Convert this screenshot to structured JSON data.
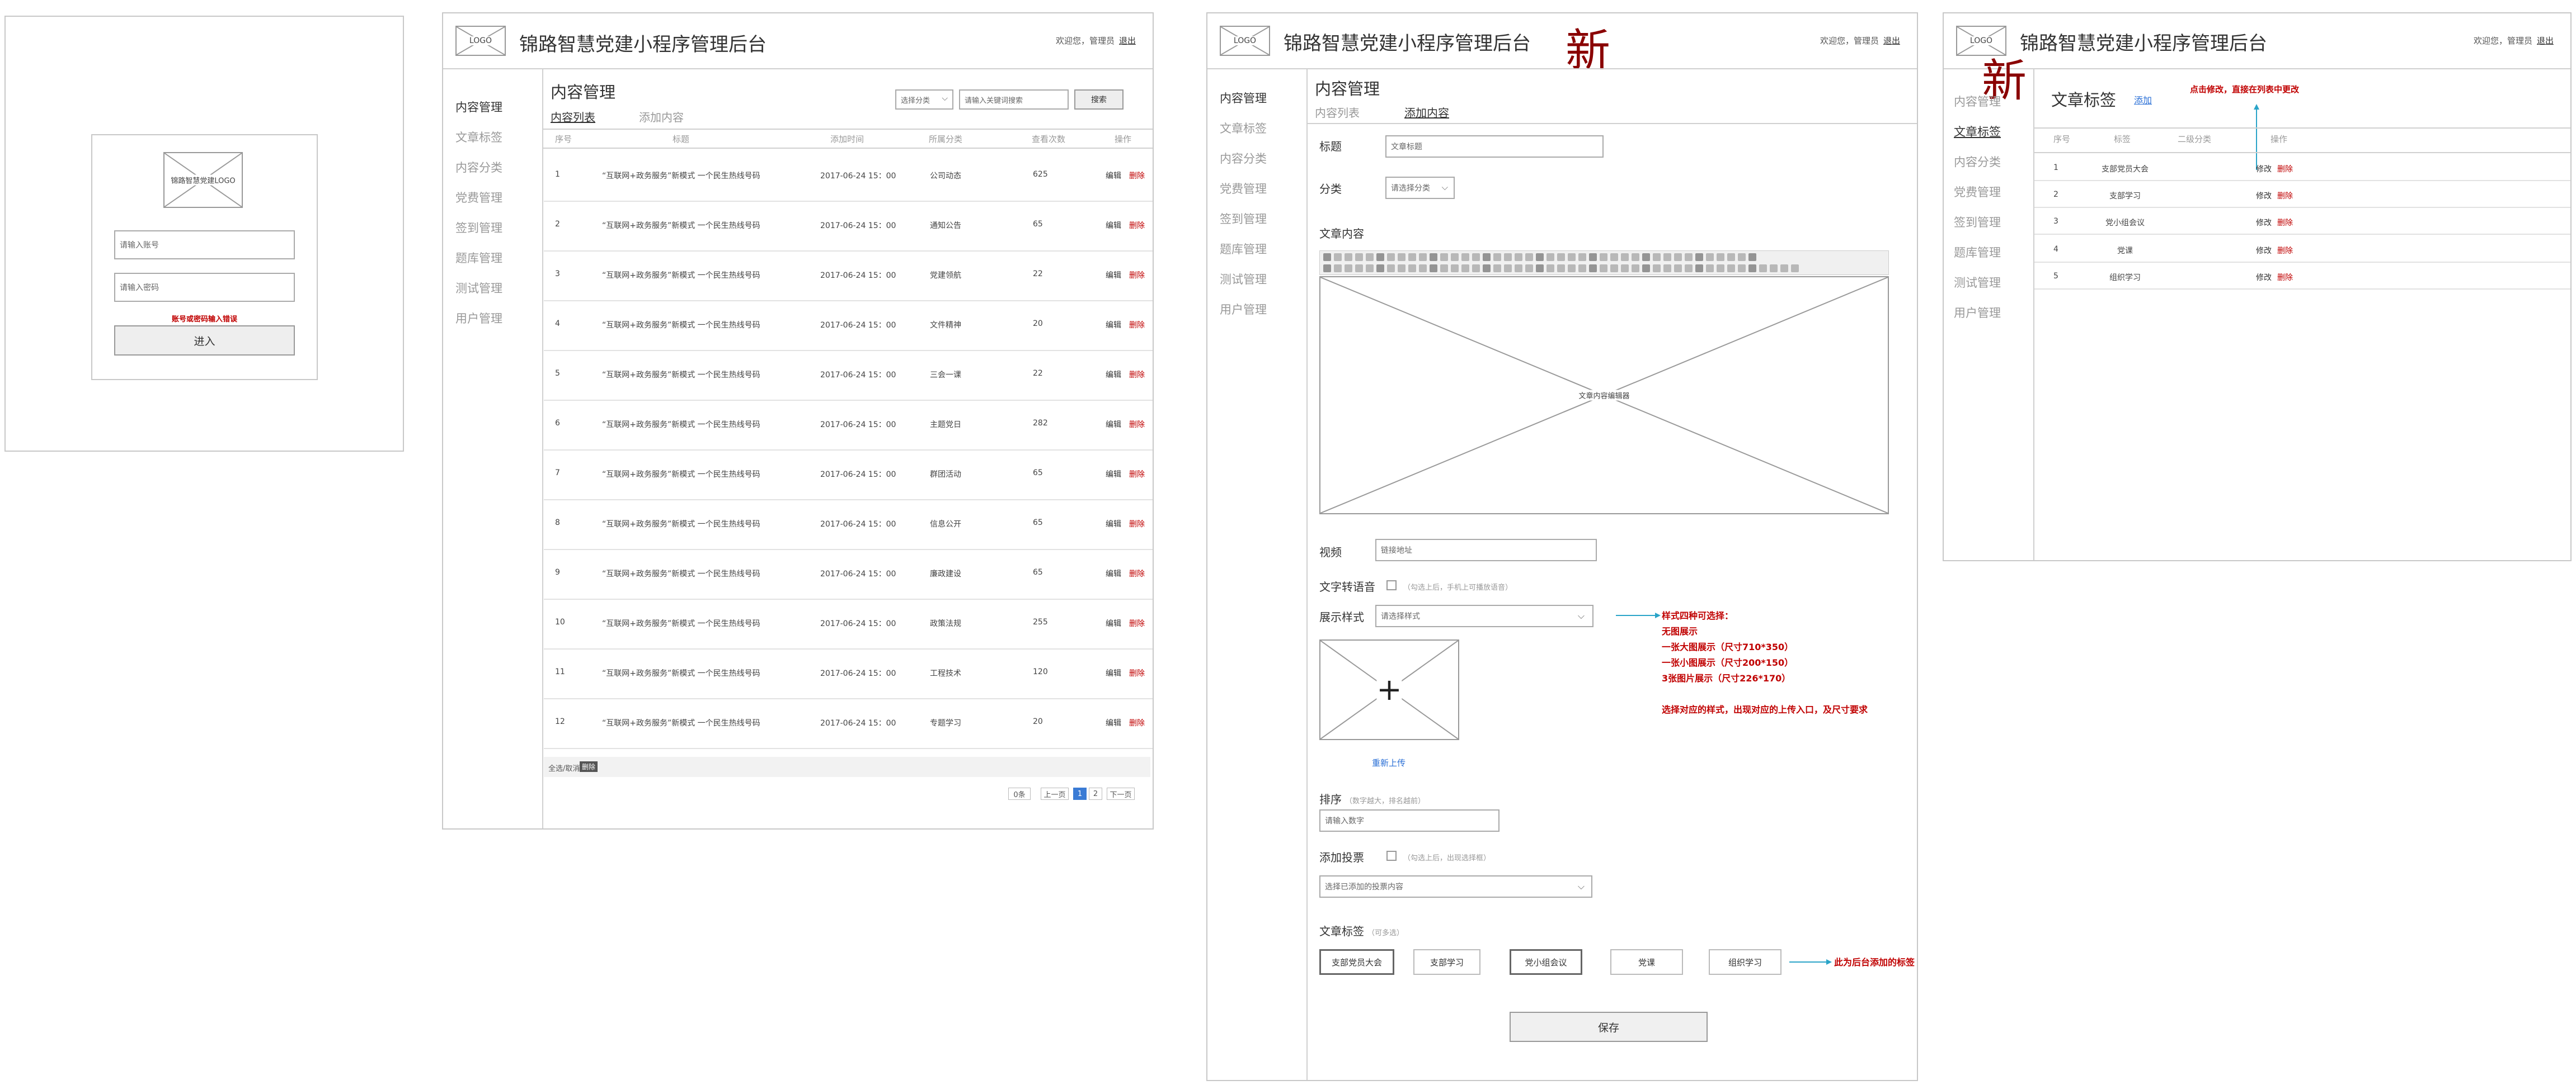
{
  "login": {
    "logo_text": "锦路智慧党建LOGO",
    "account_placeholder": "请输入账号",
    "password_placeholder": "请输入密码",
    "error": "账号或密码输入错误",
    "submit_label": "进入"
  },
  "common": {
    "logo": "LOGO",
    "app_title": "锦路智慧党建小程序管理后台",
    "welcome": "欢迎您，管理员",
    "logout": "退出",
    "new_marker": "新"
  },
  "sidebar": {
    "items": [
      "内容管理",
      "文章标签",
      "内容分类",
      "党费管理",
      "签到管理",
      "题库管理",
      "测试管理",
      "用户管理"
    ]
  },
  "content_list": {
    "page_title": "内容管理",
    "tabs": [
      "内容列表",
      "添加内容"
    ],
    "category_select": "选择分类",
    "search_placeholder": "请输入关键词搜索",
    "search_button": "搜索",
    "columns": [
      "序号",
      "标题",
      "添加时间",
      "所属分类",
      "查看次数",
      "操作"
    ],
    "edit_label": "编辑",
    "delete_label": "删除",
    "rows": [
      {
        "no": "1",
        "title": "“互联网+政务服务”新模式 一个民生热线号码",
        "time": "2017-06-24 15：00",
        "category": "公司动态",
        "views": "625"
      },
      {
        "no": "2",
        "title": "“互联网+政务服务”新模式 一个民生热线号码",
        "time": "2017-06-24 15：00",
        "category": "通知公告",
        "views": "65"
      },
      {
        "no": "3",
        "title": "“互联网+政务服务”新模式 一个民生热线号码",
        "time": "2017-06-24 15：00",
        "category": "党建领航",
        "views": "22"
      },
      {
        "no": "4",
        "title": "“互联网+政务服务”新模式 一个民生热线号码",
        "time": "2017-06-24 15：00",
        "category": "文件精神",
        "views": "20"
      },
      {
        "no": "5",
        "title": "“互联网+政务服务”新模式 一个民生热线号码",
        "time": "2017-06-24 15：00",
        "category": "三会一课",
        "views": "22"
      },
      {
        "no": "6",
        "title": "“互联网+政务服务”新模式 一个民生热线号码",
        "time": "2017-06-24 15：00",
        "category": "主题党日",
        "views": "282"
      },
      {
        "no": "7",
        "title": "“互联网+政务服务”新模式 一个民生热线号码",
        "time": "2017-06-24 15：00",
        "category": "群团活动",
        "views": "65"
      },
      {
        "no": "8",
        "title": "“互联网+政务服务”新模式 一个民生热线号码",
        "time": "2017-06-24 15：00",
        "category": "信息公开",
        "views": "65"
      },
      {
        "no": "9",
        "title": "“互联网+政务服务”新模式 一个民生热线号码",
        "time": "2017-06-24 15：00",
        "category": "廉政建设",
        "views": "65"
      },
      {
        "no": "10",
        "title": "“互联网+政务服务”新模式 一个民生热线号码",
        "time": "2017-06-24 15：00",
        "category": "政策法规",
        "views": "255"
      },
      {
        "no": "11",
        "title": "“互联网+政务服务”新模式 一个民生热线号码",
        "time": "2017-06-24 15：00",
        "category": "工程技术",
        "views": "120"
      },
      {
        "no": "12",
        "title": "“互联网+政务服务”新模式 一个民生热线号码",
        "time": "2017-06-24 15：00",
        "category": "专题学习",
        "views": "20"
      }
    ],
    "footer_select_all": "全选/取消",
    "footer_delete": "删除",
    "pager": {
      "total": "0条",
      "prev": "上一页",
      "pages": [
        "1",
        "2"
      ],
      "next": "下一页"
    }
  },
  "add_content": {
    "page_title": "内容管理",
    "tabs": [
      "内容列表",
      "添加内容"
    ],
    "title_label": "标题",
    "title_placeholder": "文章标题",
    "category_label": "分类",
    "category_select": "请选择分类",
    "body_label": "文章内容",
    "editor_placeholder": "文章内容编辑器",
    "video_label": "视频",
    "video_placeholder": "链接地址",
    "tts_label": "文字转语音",
    "tts_hint": "（勾选上后，手机上可播放语音）",
    "style_label": "展示样式",
    "style_select": "请选择样式",
    "upload_label": "重新上传",
    "sort_label": "排序",
    "sort_hint": "（数字越大，排名越前）",
    "sort_placeholder": "请输入数字",
    "vote_label": "添加投票",
    "vote_hint": "（勾选上后，出现选择框）",
    "vote_select": "选择已添加的投票内容",
    "tags_label": "文章标签",
    "tags_hint": "（可多选）",
    "tags": [
      "支部党员大会",
      "支部学习",
      "党小组会议",
      "党课",
      "组织学习"
    ],
    "tags_note": "此为后台添加的标签",
    "save_button": "保存",
    "style_note": [
      "样式四种可选择：",
      "无图展示",
      "一张大图展示（尺寸710*350）",
      "一张小图展示（尺寸200*150）",
      "3张图片展示（尺寸226*170）",
      "",
      "选择对应的样式，出现对应的上传入口，及尺寸要求"
    ]
  },
  "tag_manage": {
    "page_title": "文章标签",
    "add_label": "添加",
    "note": "点击修改，直接在列表中更改",
    "columns": [
      "序号",
      "标签",
      "二级分类",
      "操作"
    ],
    "modify_label": "修改",
    "delete_label": "删除",
    "rows": [
      {
        "no": "1",
        "tag": "支部党员大会"
      },
      {
        "no": "2",
        "tag": "支部学习"
      },
      {
        "no": "3",
        "tag": "党小组会议"
      },
      {
        "no": "4",
        "tag": "党课"
      },
      {
        "no": "5",
        "tag": "组织学习"
      }
    ]
  },
  "colors": {
    "accent_red": "#c00000",
    "arrow_blue": "#2aa4c8",
    "dark_red": "#8a0000"
  }
}
